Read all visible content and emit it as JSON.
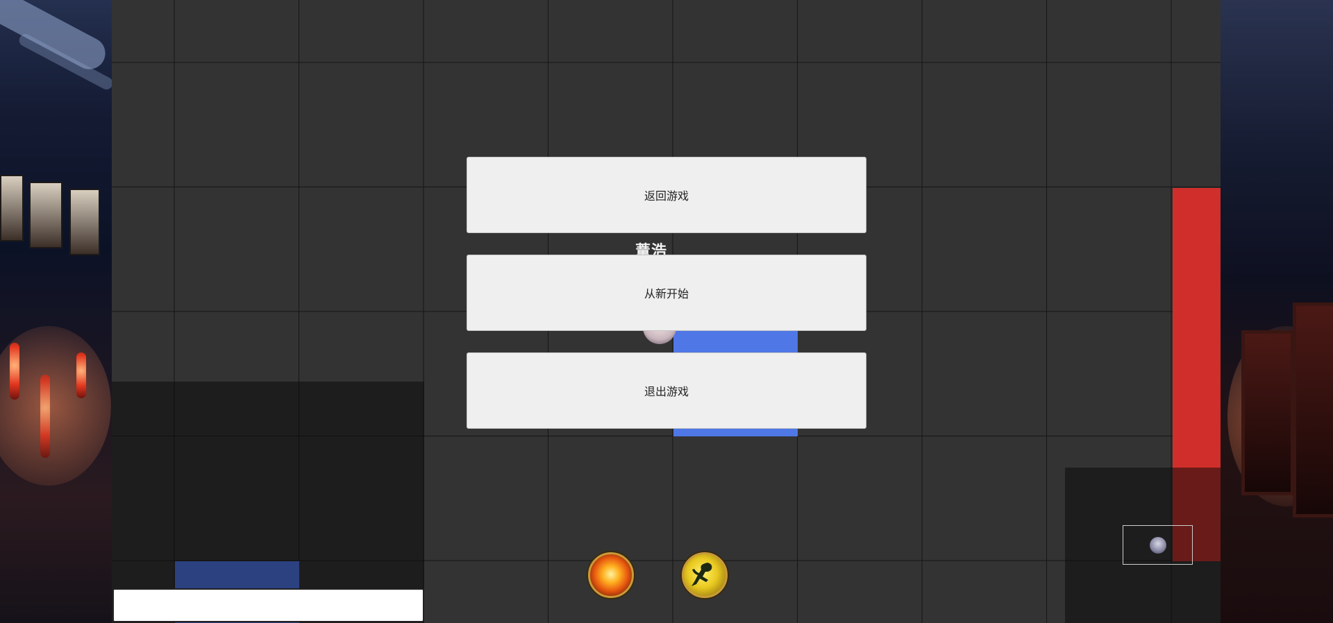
{
  "menu": {
    "resume_label": "返回游戏",
    "restart_label": "从新开始",
    "quit_label": "退出游戏"
  },
  "player": {
    "name": "蕫浩"
  },
  "skills": [
    {
      "name": "fireball",
      "icon": "fireball-icon"
    },
    {
      "name": "dash",
      "icon": "dash-icon"
    }
  ],
  "chat": {
    "value": "",
    "placeholder": ""
  },
  "colors": {
    "board": "#333333",
    "grid_line": "#151515",
    "player_tile": "#4f77e6",
    "ally_tile": "#2c4180",
    "enemy_tile": "#d02e2b",
    "menu_button": "#efefef"
  }
}
